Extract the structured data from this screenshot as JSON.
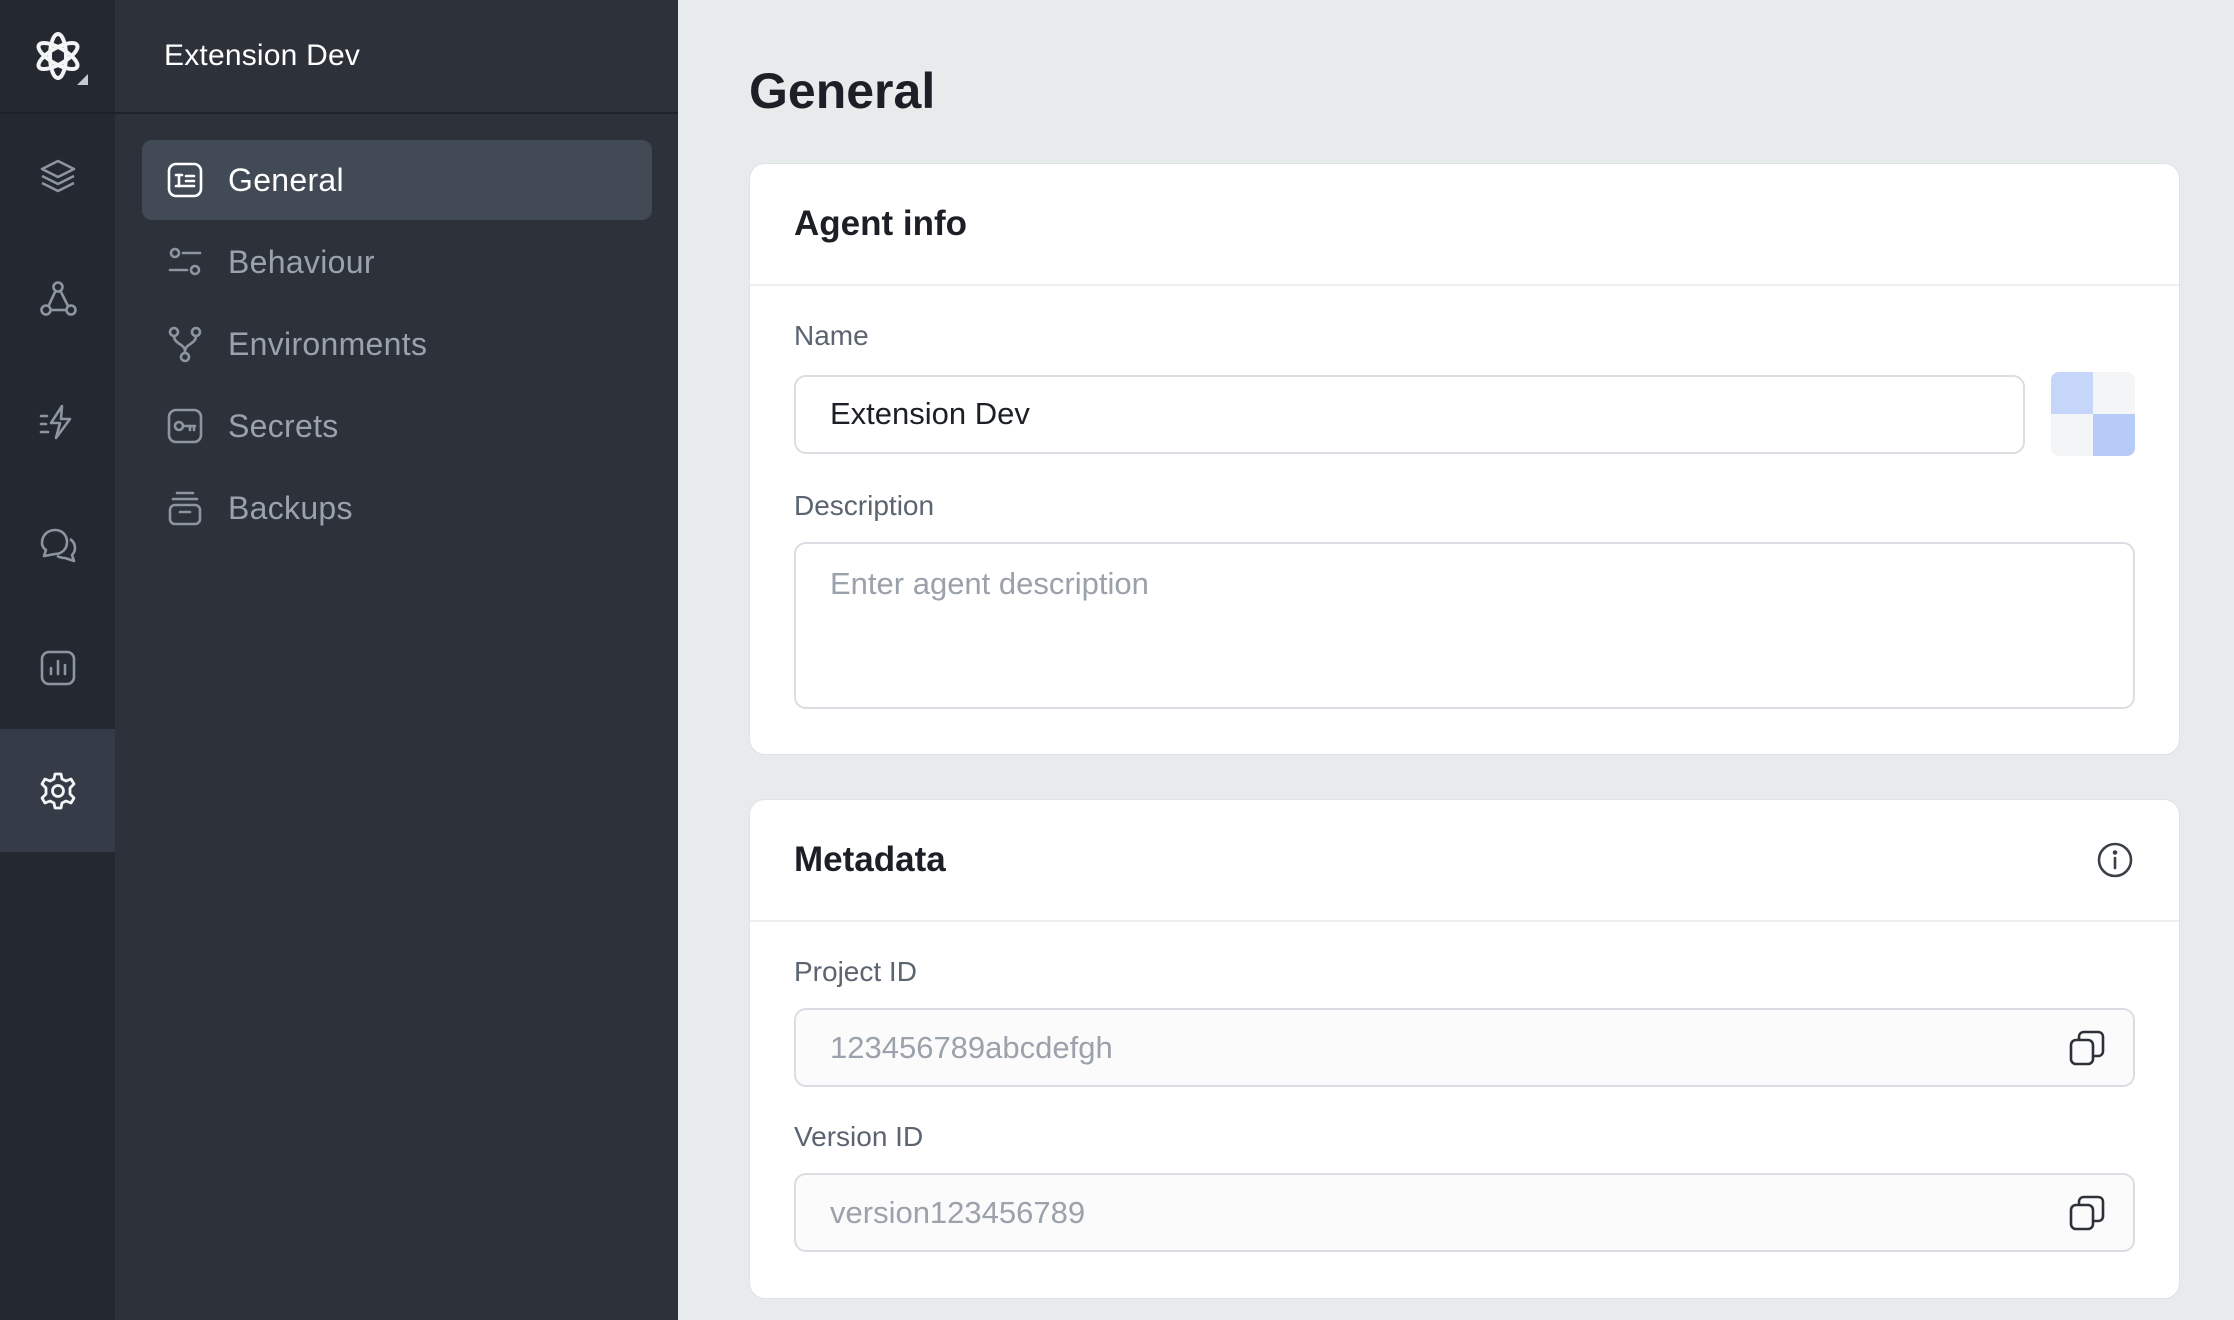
{
  "rail": {
    "items": [
      {
        "icon": "layers-icon"
      },
      {
        "icon": "flow-icon"
      },
      {
        "icon": "lightning-icon"
      },
      {
        "icon": "chat-icon"
      },
      {
        "icon": "analytics-icon"
      },
      {
        "icon": "gear-icon",
        "active": true
      }
    ]
  },
  "sidebar": {
    "title": "Extension Dev",
    "items": [
      {
        "label": "General",
        "icon": "general-icon",
        "active": true
      },
      {
        "label": "Behaviour",
        "icon": "sliders-icon"
      },
      {
        "label": "Environments",
        "icon": "branch-icon"
      },
      {
        "label": "Secrets",
        "icon": "key-icon"
      },
      {
        "label": "Backups",
        "icon": "archive-icon"
      }
    ]
  },
  "main": {
    "title": "General",
    "agent_info": {
      "title": "Agent info",
      "name_label": "Name",
      "name_value": "Extension Dev",
      "description_label": "Description",
      "description_placeholder": "Enter agent description"
    },
    "metadata": {
      "title": "Metadata",
      "project_id_label": "Project ID",
      "project_id_value": "123456789abcdefgh",
      "version_id_label": "Version ID",
      "version_id_value": "version123456789"
    }
  },
  "colors": {
    "rail_bg": "#232831",
    "sidebar_bg": "#2c313a",
    "active_nav_bg": "#424a55",
    "page_bg": "#e8ebec",
    "avatar_blue": "#b6cbf7"
  }
}
